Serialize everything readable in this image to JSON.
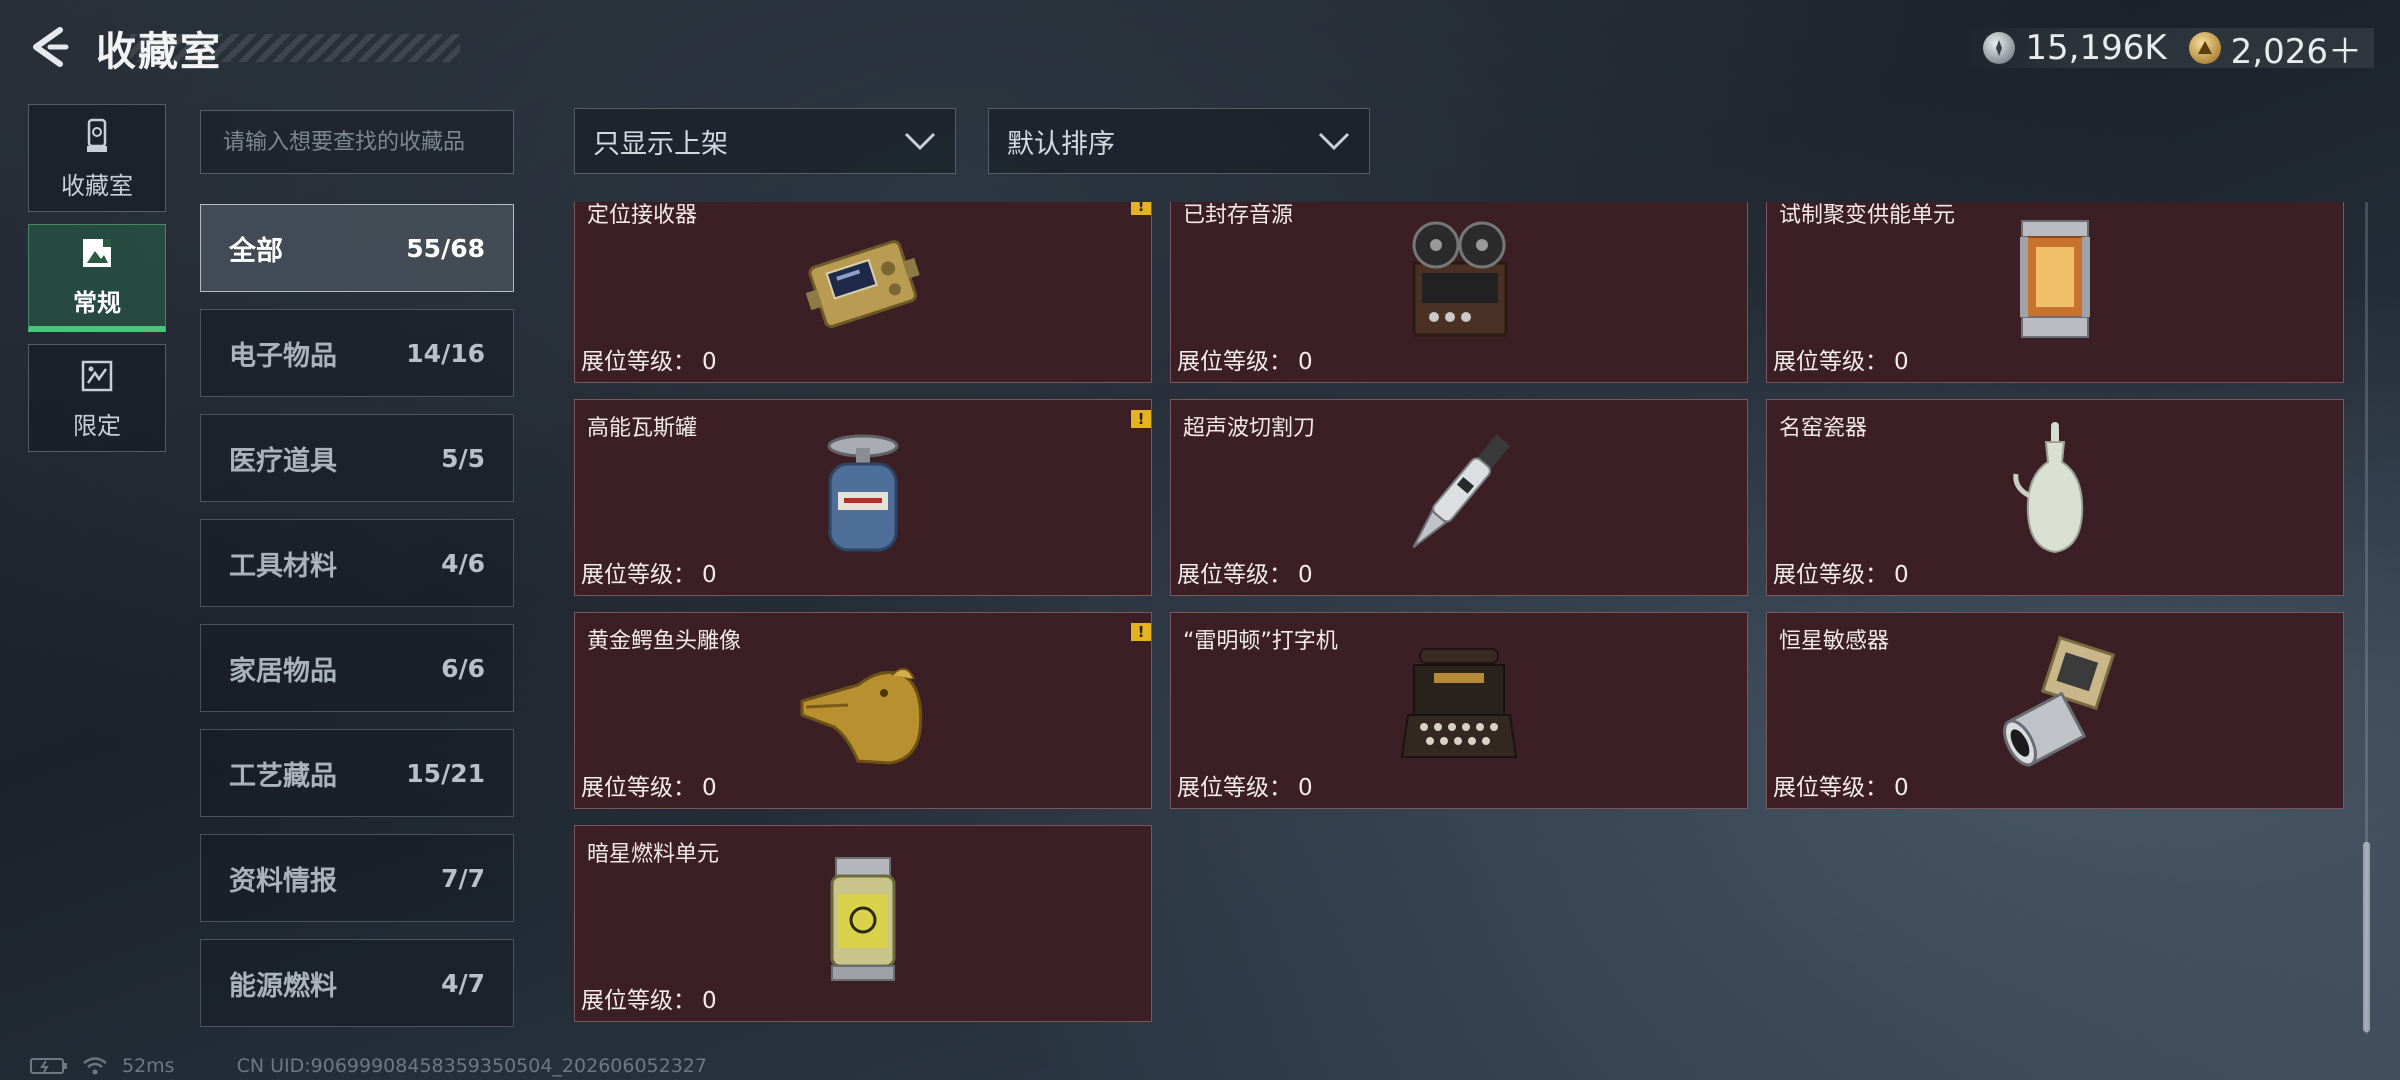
{
  "header": {
    "title": "收藏室",
    "currencies": [
      {
        "icon": "silver-coin-icon",
        "value": "15,196K"
      },
      {
        "icon": "gold-coin-icon",
        "value": "2,026＋"
      }
    ]
  },
  "rail": [
    {
      "label": "收藏室",
      "icon": "trophy-icon",
      "active": false
    },
    {
      "label": "常规",
      "icon": "picture-icon",
      "active": true
    },
    {
      "label": "限定",
      "icon": "limited-icon",
      "active": false
    }
  ],
  "search": {
    "placeholder": "请输入想要查找的收藏品",
    "value": ""
  },
  "filters": {
    "display": "只显示上架",
    "sort": "默认排序"
  },
  "categories": [
    {
      "label": "全部",
      "count": "55/68"
    },
    {
      "label": "电子物品",
      "count": "14/16"
    },
    {
      "label": "医疗道具",
      "count": "5/5"
    },
    {
      "label": "工具材料",
      "count": "4/6"
    },
    {
      "label": "家居物品",
      "count": "6/6"
    },
    {
      "label": "工艺藏品",
      "count": "15/21"
    },
    {
      "label": "资料情报",
      "count": "7/7"
    },
    {
      "label": "能源燃料",
      "count": "4/7"
    }
  ],
  "level_label": "展位等级：",
  "items": [
    {
      "name": "定位接收器",
      "level": "0",
      "warning": "!"
    },
    {
      "name": "已封存音源",
      "level": "0"
    },
    {
      "name": "试制聚变供能单元",
      "level": "0"
    },
    {
      "name": "高能瓦斯罐",
      "level": "0",
      "warning": "!"
    },
    {
      "name": "超声波切割刀",
      "level": "0"
    },
    {
      "name": "名窑瓷器",
      "level": "0"
    },
    {
      "name": "黄金鳄鱼头雕像",
      "level": "0",
      "warning": "!"
    },
    {
      "name": "“雷明顿”打字机",
      "level": "0"
    },
    {
      "name": "恒星敏感器",
      "level": "0"
    },
    {
      "name": "暗星燃料单元",
      "level": "0"
    }
  ],
  "footer": {
    "ping": "52ms",
    "uid": "CN UID:9069990845835935050​4_202606052327"
  },
  "colors": {
    "card_bg": "#3c1f24",
    "active_green": "#46c979",
    "warning": "#e5b31f"
  }
}
